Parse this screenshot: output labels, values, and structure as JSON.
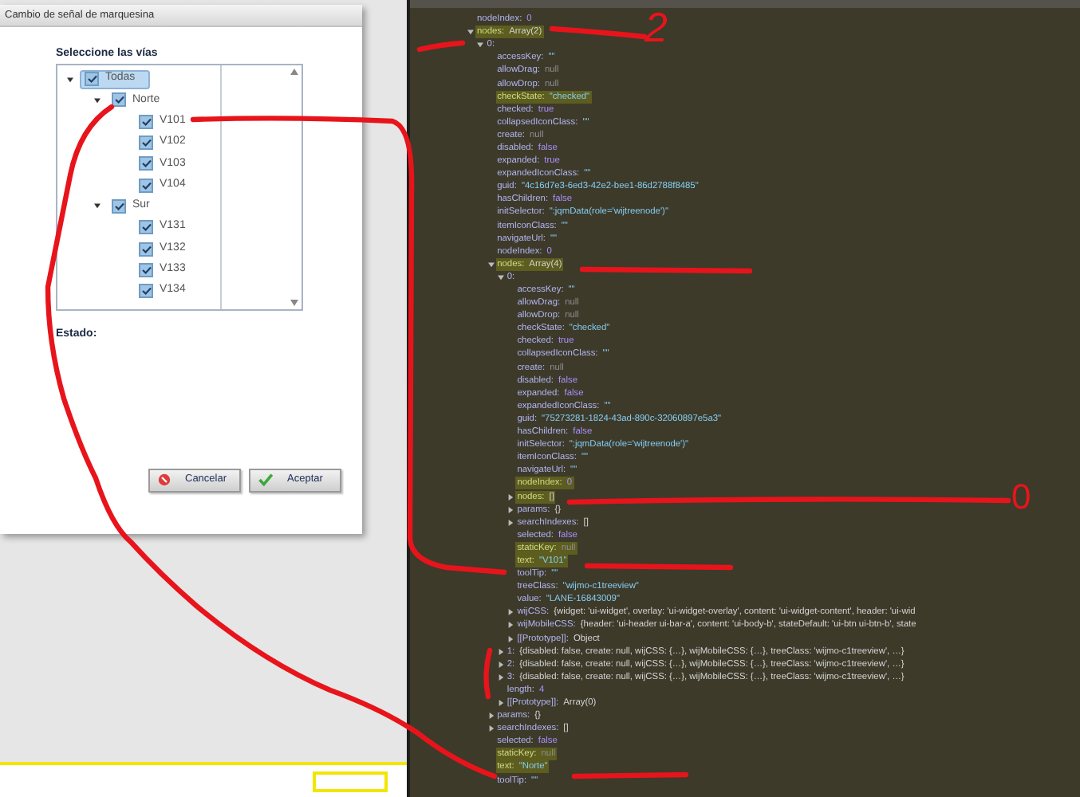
{
  "dialog": {
    "title": "Cambio de señal de marquesina",
    "tree_label": "Seleccione las vías",
    "tree": [
      {
        "label": "Todas",
        "checked": true,
        "selected": true,
        "expanded": true,
        "children": [
          {
            "label": "Norte",
            "checked": true,
            "selected": false,
            "expanded": true,
            "children": [
              {
                "label": "V101",
                "checked": true,
                "selected": false
              },
              {
                "label": "V102",
                "checked": true,
                "selected": false
              },
              {
                "label": "V103",
                "checked": true,
                "selected": false
              },
              {
                "label": "V104",
                "checked": true,
                "selected": false
              }
            ]
          },
          {
            "label": "Sur",
            "checked": true,
            "selected": false,
            "expanded": true,
            "children": [
              {
                "label": "V131",
                "checked": true,
                "selected": false
              },
              {
                "label": "V132",
                "checked": true,
                "selected": false
              },
              {
                "label": "V133",
                "checked": true,
                "selected": false
              },
              {
                "label": "V134",
                "checked": true,
                "selected": false
              }
            ]
          }
        ]
      }
    ],
    "status_label": "Estado:",
    "buttons": [
      {
        "label": "Cancelar",
        "kind": "cancel"
      },
      {
        "label": "Aceptar",
        "kind": "accept"
      }
    ]
  },
  "console": {
    "lines": [
      {
        "key": "nodeIndex:",
        "value": "0",
        "kind": "number",
        "highlighted": false
      },
      {
        "key": "nodes:",
        "value": "Array(2)",
        "kind": "object",
        "highlighted": true,
        "expanded": true,
        "children": [
          {
            "key": "0:",
            "highlighted": false,
            "expanded": true,
            "children": [
              {
                "key": "accessKey:",
                "value": "\"\"",
                "kind": "string",
                "highlighted": false
              },
              {
                "key": "allowDrag:",
                "value": "null",
                "kind": "null",
                "highlighted": false
              },
              {
                "key": "allowDrop:",
                "value": "null",
                "kind": "null",
                "highlighted": false
              },
              {
                "key": "checkState:",
                "value": "\"checked\"",
                "kind": "string",
                "highlighted": true
              },
              {
                "key": "checked:",
                "value": "true",
                "kind": "keyword",
                "highlighted": false
              },
              {
                "key": "collapsedIconClass:",
                "value": "\"\"",
                "kind": "string",
                "highlighted": false
              },
              {
                "key": "create:",
                "value": "null",
                "kind": "null",
                "highlighted": false
              },
              {
                "key": "disabled:",
                "value": "false",
                "kind": "keyword",
                "highlighted": false
              },
              {
                "key": "expanded:",
                "value": "true",
                "kind": "keyword",
                "highlighted": false
              },
              {
                "key": "expandedIconClass:",
                "value": "\"\"",
                "kind": "string",
                "highlighted": false
              },
              {
                "key": "guid:",
                "value": "\"4c16d7e3-6ed3-42e2-bee1-86d2788f8485\"",
                "kind": "string",
                "highlighted": false
              },
              {
                "key": "hasChildren:",
                "value": "false",
                "kind": "keyword",
                "highlighted": false
              },
              {
                "key": "initSelector:",
                "value": "\":jqmData(role='wijtreenode')\"",
                "kind": "string",
                "highlighted": false
              },
              {
                "key": "itemIconClass:",
                "value": "\"\"",
                "kind": "string",
                "highlighted": false
              },
              {
                "key": "navigateUrl:",
                "value": "\"\"",
                "kind": "string",
                "highlighted": false
              },
              {
                "key": "nodeIndex:",
                "value": "0",
                "kind": "number",
                "highlighted": false
              },
              {
                "key": "nodes:",
                "value": "Array(4)",
                "kind": "object",
                "highlighted": true,
                "expanded": true,
                "children": [
                  {
                    "key": "0:",
                    "highlighted": false,
                    "expanded": true,
                    "children": [
                      {
                        "key": "accessKey:",
                        "value": "\"\"",
                        "kind": "string",
                        "highlighted": false
                      },
                      {
                        "key": "allowDrag:",
                        "value": "null",
                        "kind": "null",
                        "highlighted": false
                      },
                      {
                        "key": "allowDrop:",
                        "value": "null",
                        "kind": "null",
                        "highlighted": false
                      },
                      {
                        "key": "checkState:",
                        "value": "\"checked\"",
                        "kind": "string",
                        "highlighted": false
                      },
                      {
                        "key": "checked:",
                        "value": "true",
                        "kind": "keyword",
                        "highlighted": false
                      },
                      {
                        "key": "collapsedIconClass:",
                        "value": "\"\"",
                        "kind": "string",
                        "highlighted": false
                      },
                      {
                        "key": "create:",
                        "value": "null",
                        "kind": "null",
                        "highlighted": false
                      },
                      {
                        "key": "disabled:",
                        "value": "false",
                        "kind": "keyword",
                        "highlighted": false
                      },
                      {
                        "key": "expanded:",
                        "value": "false",
                        "kind": "keyword",
                        "highlighted": false
                      },
                      {
                        "key": "expandedIconClass:",
                        "value": "\"\"",
                        "kind": "string",
                        "highlighted": false
                      },
                      {
                        "key": "guid:",
                        "value": "\"75273281-1824-43ad-890c-32060897e5a3\"",
                        "kind": "string",
                        "highlighted": false
                      },
                      {
                        "key": "hasChildren:",
                        "value": "false",
                        "kind": "keyword",
                        "highlighted": false
                      },
                      {
                        "key": "initSelector:",
                        "value": "\":jqmData(role='wijtreenode')\"",
                        "kind": "string",
                        "highlighted": false
                      },
                      {
                        "key": "itemIconClass:",
                        "value": "\"\"",
                        "kind": "string",
                        "highlighted": false
                      },
                      {
                        "key": "navigateUrl:",
                        "value": "\"\"",
                        "kind": "string",
                        "highlighted": false
                      },
                      {
                        "key": "nodeIndex:",
                        "value": "0",
                        "kind": "number",
                        "highlighted": true
                      },
                      {
                        "key": "nodes:",
                        "value": "[]",
                        "kind": "object",
                        "highlighted": true,
                        "expanded": false
                      },
                      {
                        "key": "params:",
                        "value": "{}",
                        "kind": "object",
                        "highlighted": false,
                        "expanded": false
                      },
                      {
                        "key": "searchIndexes:",
                        "value": "[]",
                        "kind": "object",
                        "highlighted": false,
                        "expanded": false
                      },
                      {
                        "key": "selected:",
                        "value": "false",
                        "kind": "keyword",
                        "highlighted": false
                      },
                      {
                        "key": "staticKey:",
                        "value": "null",
                        "kind": "null",
                        "highlighted": true
                      },
                      {
                        "key": "text:",
                        "value": "\"V101\"",
                        "kind": "string",
                        "highlighted": true
                      },
                      {
                        "key": "toolTip:",
                        "value": "\"\"",
                        "kind": "string",
                        "highlighted": false
                      },
                      {
                        "key": "treeClass:",
                        "value": "\"wijmo-c1treeview\"",
                        "kind": "string",
                        "highlighted": false
                      },
                      {
                        "key": "value:",
                        "value": "\"LANE-16843009\"",
                        "kind": "string",
                        "highlighted": false
                      },
                      {
                        "key": "wijCSS:",
                        "value": "{widget: 'ui-widget', overlay: 'ui-widget-overlay', content: 'ui-widget-content', header: 'ui-wid",
                        "kind": "object",
                        "highlighted": false,
                        "expanded": false
                      },
                      {
                        "key": "wijMobileCSS:",
                        "value": "{header: 'ui-header ui-bar-a', content: 'ui-body-b', stateDefault: 'ui-btn ui-btn-b', state",
                        "kind": "object",
                        "highlighted": false,
                        "expanded": false
                      },
                      {
                        "key": "[[Prototype]]:",
                        "value": "Object",
                        "kind": "object",
                        "highlighted": false,
                        "expanded": false
                      }
                    ]
                  },
                  {
                    "key": "1:",
                    "value": "{disabled: false, create: null, wijCSS: {…}, wijMobileCSS: {…}, treeClass: 'wijmo-c1treeview', …}",
                    "kind": "object",
                    "highlighted": false,
                    "expanded": false
                  },
                  {
                    "key": "2:",
                    "value": "{disabled: false, create: null, wijCSS: {…}, wijMobileCSS: {…}, treeClass: 'wijmo-c1treeview', …}",
                    "kind": "object",
                    "highlighted": false,
                    "expanded": false
                  },
                  {
                    "key": "3:",
                    "value": "{disabled: false, create: null, wijCSS: {…}, wijMobileCSS: {…}, treeClass: 'wijmo-c1treeview', …}",
                    "kind": "object",
                    "highlighted": false,
                    "expanded": false
                  },
                  {
                    "key": "length:",
                    "value": "4",
                    "kind": "number",
                    "highlighted": false
                  },
                  {
                    "key": "[[Prototype]]:",
                    "value": "Array(0)",
                    "kind": "object",
                    "highlighted": false,
                    "expanded": false
                  }
                ]
              },
              {
                "key": "params:",
                "value": "{}",
                "kind": "object",
                "highlighted": false,
                "expanded": false
              },
              {
                "key": "searchIndexes:",
                "value": "[]",
                "kind": "object",
                "highlighted": false,
                "expanded": false
              },
              {
                "key": "selected:",
                "value": "false",
                "kind": "keyword",
                "highlighted": false
              },
              {
                "key": "staticKey:",
                "value": "null",
                "kind": "null",
                "highlighted": true
              },
              {
                "key": "text:",
                "value": "\"Norte\"",
                "kind": "string",
                "highlighted": true
              },
              {
                "key": "toolTip:",
                "value": "\"\"",
                "kind": "string",
                "highlighted": false
              }
            ]
          }
        ]
      }
    ]
  },
  "annotations": [
    {
      "text": "2"
    },
    {
      "text": "0"
    }
  ]
}
